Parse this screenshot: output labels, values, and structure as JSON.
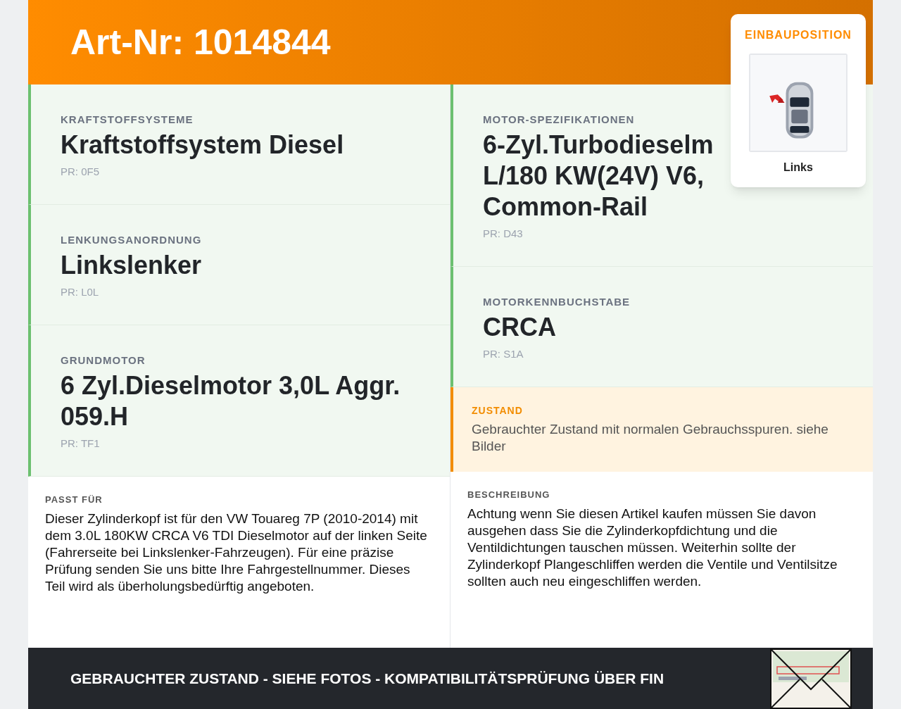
{
  "header": {
    "title": "Art-Nr: 1014844"
  },
  "position_card": {
    "label": "EINBAUPOSITION",
    "caption": "Links"
  },
  "columns": [
    {
      "items": [
        {
          "kind": "spec",
          "label": "KRAFTSTOFFSYSTEME",
          "lines": [
            "Kraftstoffsystem Diesel"
          ],
          "code": "PR: 0F5"
        },
        {
          "kind": "spec",
          "label": "LENKUNGSANORDNUNG",
          "lines": [
            "Linkslenker"
          ],
          "code": "PR: L0L"
        },
        {
          "kind": "spec",
          "label": "GRUNDMOTOR",
          "lines": [
            "6 Zyl.Dieselmotor 3,0L Aggr.",
            "059.H"
          ],
          "code": "PR: TF1"
        },
        {
          "kind": "description",
          "label": "PASST FÜR",
          "text": "Dieser Zylinderkopf ist für den VW Touareg 7P (2010-2014) mit dem 3.0L 180KW CRCA V6 TDI Dieselmotor auf der linken Seite (Fahrerseite bei Linkslenker-Fahrzeugen). Für eine präzise Prüfung senden Sie uns bitte Ihre Fahrgestellnummer. Dieses Teil wird als überholungsbedürftig angeboten."
        }
      ]
    },
    {
      "items": [
        {
          "kind": "spec",
          "label": "MOTOR-SPEZIFIKATIONEN",
          "lines": [
            "6-Zyl.Turbodieselm",
            "L/180 KW(24V) V6,",
            "Common-Rail"
          ],
          "code": "PR: D43"
        },
        {
          "kind": "spec",
          "label": "MOTORKENNBUCHSTABE",
          "lines": [
            "CRCA"
          ],
          "code": "PR: S1A"
        },
        {
          "kind": "condition",
          "label": "ZUSTAND",
          "text": "Gebrauchter Zustand mit normalen Gebrauchsspuren. siehe Bilder"
        },
        {
          "kind": "description",
          "label": "BESCHREIBUNG",
          "text": "Achtung wenn Sie diesen Artikel kaufen müssen Sie davon ausgehen dass Sie die Zylinderkopfdichtung und die Ventildichtungen tauschen müssen. Weiterhin sollte der Zylinderkopf Plangeschliffen werden die Ventile und Ventilsitze sollten auch neu eingeschliffen werden."
        }
      ]
    }
  ],
  "footer": {
    "text": "GEBRAUCHTER ZUSTAND - SIEHE FOTOS - KOMPATIBILITÄTSPRÜFUNG ÜBER FIN"
  }
}
